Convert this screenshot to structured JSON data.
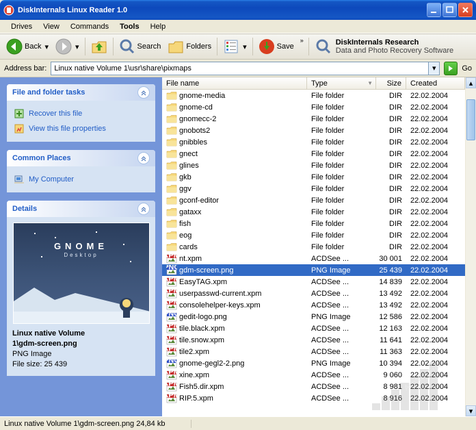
{
  "window": {
    "title": "DiskInternals Linux Reader 1.0"
  },
  "menu": {
    "drives": "Drives",
    "view": "View",
    "commands": "Commands",
    "tools": "Tools",
    "help": "Help"
  },
  "toolbar": {
    "back": "Back",
    "search": "Search",
    "folders": "Folders",
    "save": "Save",
    "promo_title": "DiskInternals Research",
    "promo_sub": "Data and Photo Recovery Software"
  },
  "address": {
    "label": "Address bar:",
    "value": "Linux native Volume 1\\usr\\share\\pixmaps",
    "go": "Go"
  },
  "side": {
    "tasks_title": "File and folder tasks",
    "recover": "Recover this file",
    "props": "View this file properties",
    "places_title": "Common Places",
    "mycomputer": "My Computer",
    "details_title": "Details",
    "detail_path1": "Linux native Volume",
    "detail_path2": "1\\gdm-screen.png",
    "detail_type": "PNG Image",
    "detail_size": "File size: 25 439"
  },
  "cols": {
    "name": "File name",
    "type": "Type",
    "size": "Size",
    "created": "Created"
  },
  "files": [
    {
      "name": "gnome-media",
      "type": "File folder",
      "size": "DIR",
      "created": "22.02.2004",
      "icon": "folder"
    },
    {
      "name": "gnome-cd",
      "type": "File folder",
      "size": "DIR",
      "created": "22.02.2004",
      "icon": "folder"
    },
    {
      "name": "gnomecc-2",
      "type": "File folder",
      "size": "DIR",
      "created": "22.02.2004",
      "icon": "folder"
    },
    {
      "name": "gnobots2",
      "type": "File folder",
      "size": "DIR",
      "created": "22.02.2004",
      "icon": "folder"
    },
    {
      "name": "gnibbles",
      "type": "File folder",
      "size": "DIR",
      "created": "22.02.2004",
      "icon": "folder"
    },
    {
      "name": "gnect",
      "type": "File folder",
      "size": "DIR",
      "created": "22.02.2004",
      "icon": "folder"
    },
    {
      "name": "glines",
      "type": "File folder",
      "size": "DIR",
      "created": "22.02.2004",
      "icon": "folder"
    },
    {
      "name": "gkb",
      "type": "File folder",
      "size": "DIR",
      "created": "22.02.2004",
      "icon": "folder"
    },
    {
      "name": "ggv",
      "type": "File folder",
      "size": "DIR",
      "created": "22.02.2004",
      "icon": "folder"
    },
    {
      "name": "gconf-editor",
      "type": "File folder",
      "size": "DIR",
      "created": "22.02.2004",
      "icon": "folder"
    },
    {
      "name": "gataxx",
      "type": "File folder",
      "size": "DIR",
      "created": "22.02.2004",
      "icon": "folder"
    },
    {
      "name": "fish",
      "type": "File folder",
      "size": "DIR",
      "created": "22.02.2004",
      "icon": "folder"
    },
    {
      "name": "eog",
      "type": "File folder",
      "size": "DIR",
      "created": "22.02.2004",
      "icon": "folder"
    },
    {
      "name": "cards",
      "type": "File folder",
      "size": "DIR",
      "created": "22.02.2004",
      "icon": "folder"
    },
    {
      "name": "nt.xpm",
      "type": "ACDSee ...",
      "size": "30 001",
      "created": "22.02.2004",
      "icon": "xpm"
    },
    {
      "name": "gdm-screen.png",
      "type": "PNG Image",
      "size": "25 439",
      "created": "22.02.2004",
      "icon": "png",
      "selected": true
    },
    {
      "name": "EasyTAG.xpm",
      "type": "ACDSee ...",
      "size": "14 839",
      "created": "22.02.2004",
      "icon": "xpm"
    },
    {
      "name": "userpasswd-current.xpm",
      "type": "ACDSee ...",
      "size": "13 492",
      "created": "22.02.2004",
      "icon": "xpm"
    },
    {
      "name": "consolehelper-keys.xpm",
      "type": "ACDSee ...",
      "size": "13 492",
      "created": "22.02.2004",
      "icon": "xpm"
    },
    {
      "name": "gedit-logo.png",
      "type": "PNG Image",
      "size": "12 586",
      "created": "22.02.2004",
      "icon": "png"
    },
    {
      "name": "tile.black.xpm",
      "type": "ACDSee ...",
      "size": "12 163",
      "created": "22.02.2004",
      "icon": "xpm"
    },
    {
      "name": "tile.snow.xpm",
      "type": "ACDSee ...",
      "size": "11 641",
      "created": "22.02.2004",
      "icon": "xpm"
    },
    {
      "name": "tile2.xpm",
      "type": "ACDSee ...",
      "size": "11 363",
      "created": "22.02.2004",
      "icon": "xpm"
    },
    {
      "name": "gnome-gegl2-2.png",
      "type": "PNG Image",
      "size": "10 394",
      "created": "22.02.2004",
      "icon": "png"
    },
    {
      "name": "xine.xpm",
      "type": "ACDSee ...",
      "size": "9 060",
      "created": "22.02.2004",
      "icon": "xpm"
    },
    {
      "name": "Fish5.dir.xpm",
      "type": "ACDSee ...",
      "size": "8 981",
      "created": "22.02.2004",
      "icon": "xpm"
    },
    {
      "name": "RIP.5.xpm",
      "type": "ACDSee ...",
      "size": "8 916",
      "created": "22.02.2004",
      "icon": "xpm"
    }
  ],
  "status": {
    "path": "Linux native Volume 1\\gdm-screen.png",
    "size": "24,84 kb"
  }
}
